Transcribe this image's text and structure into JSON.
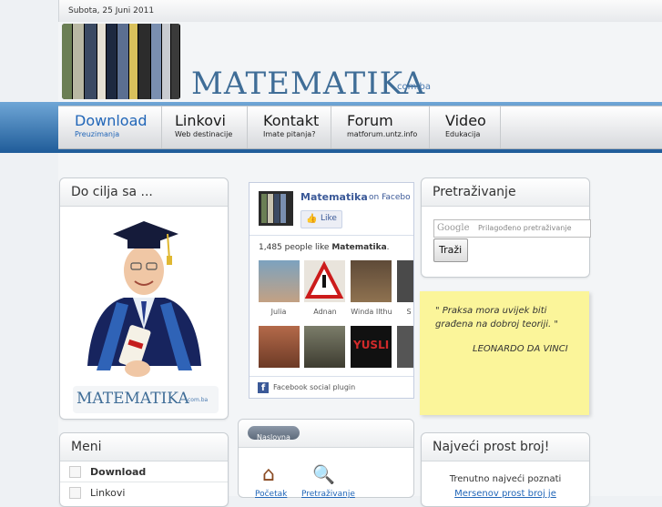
{
  "topbar": {
    "date": "Subota, 25 Juni 2011"
  },
  "header": {
    "logo_text": "MATEMATIKA",
    "logo_suffix": "com.ba",
    "book_spines": [
      "Mathematics",
      "CALCULUS",
      "THE CALCULUS LIFESAVER",
      "",
      "",
      "",
      "Euler",
      "",
      ""
    ]
  },
  "nav": {
    "items": [
      {
        "label": "Download",
        "sub": "Preuzimanja",
        "active": true
      },
      {
        "label": "Linkovi",
        "sub": "Web destinacije"
      },
      {
        "label": "Kontakt",
        "sub": "Imate pitanja?"
      },
      {
        "label": "Forum",
        "sub": "matforum.untz.info"
      },
      {
        "label": "Video",
        "sub": "Edukacija"
      }
    ]
  },
  "left_box": {
    "title": "Do cilja sa ...",
    "logo": "MATEMATIKA",
    "logo_suffix": "com.ba"
  },
  "menu": {
    "title": "Meni",
    "items": [
      "Download",
      "Linkovi"
    ]
  },
  "facebook": {
    "page_name": "Matematika",
    "on_fb": "on Facebo",
    "like_button": "Like",
    "likes_count": "1,485 people like",
    "likes_page": "Matematika",
    "fans": [
      "Julia",
      "Adnan",
      "Winda Ilthu",
      "S"
    ],
    "plugin_label": "Facebook social plugin"
  },
  "search": {
    "title": "Pretraživanje",
    "placeholder": "Prilagođeno pretraživanje",
    "google": "Google",
    "button": "Traži"
  },
  "quote": {
    "text": "\" Praksa mora uvijek biti građena na dobroj teoriji. \"",
    "author": "LEONARDO DA VINCI"
  },
  "center_tab": {
    "tab_label": "Naslovna",
    "icons": [
      "Početak",
      "Pretraživanje"
    ]
  },
  "prime_box": {
    "title": "Najveći prost broj!",
    "text": "Trenutno najveći poznati",
    "link": "Mersenov prost broj je"
  }
}
